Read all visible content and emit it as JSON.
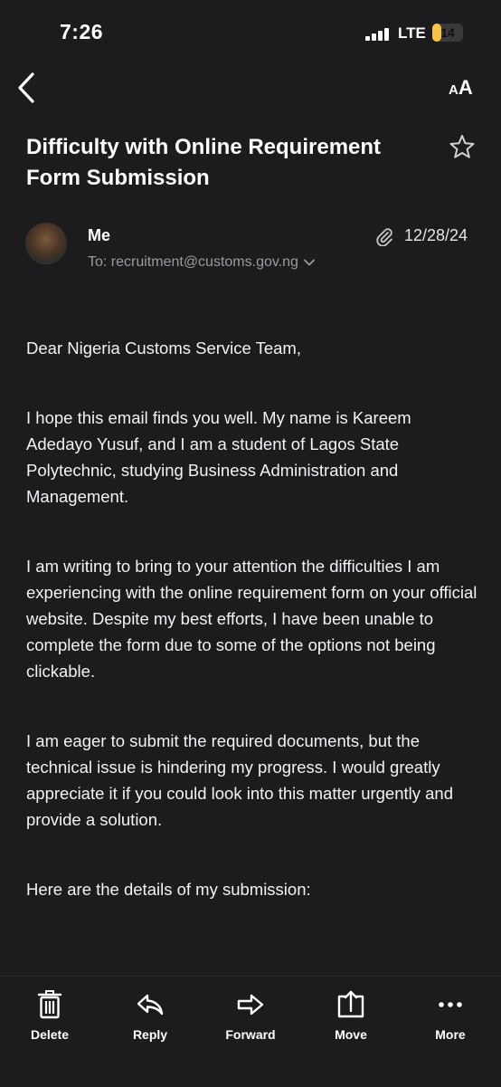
{
  "status": {
    "time": "7:26",
    "network": "LTE",
    "battery": "14",
    "battery_level": 0.14
  },
  "email": {
    "subject": "Difficulty with Online Requirement Form Submission",
    "sender": "Me",
    "to": "To: recruitment@customs.gov.ng",
    "date": "12/28/24",
    "paragraphs": [
      "Dear Nigeria Customs Service Team,",
      "I hope this email finds you well. My name is Kareem Adedayo Yusuf, and I am a student of Lagos State Polytechnic, studying Business Administration and Management.",
      "I am writing to bring to your attention the difficulties I am experiencing with the online requirement form on your official website. Despite my best efforts, I have been unable to complete the form due to some of the options not being clickable.",
      "I am eager to submit the required documents, but the technical issue is hindering my progress. I would greatly appreciate it if you could look into this matter urgently and provide a solution.",
      "Here are the details of my submission:"
    ]
  },
  "toolbar": {
    "delete": "Delete",
    "reply": "Reply",
    "forward": "Forward",
    "move": "Move",
    "more": "More"
  },
  "colors": {
    "background": "#1c1c1e",
    "battery": "#f6c343",
    "secondary_text": "#9a9aa0"
  }
}
